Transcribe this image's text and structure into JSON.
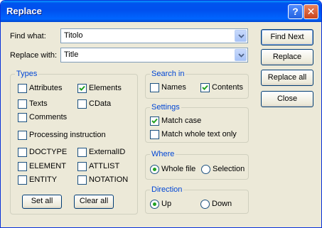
{
  "window": {
    "title": "Replace",
    "help_glyph": "?",
    "close_glyph": "✕"
  },
  "find": {
    "label": "Find what:",
    "value": "Titolo"
  },
  "replace": {
    "label": "Replace with:",
    "value": "Title"
  },
  "buttons": {
    "find_next": "Find Next",
    "replace": "Replace",
    "replace_all": "Replace all",
    "close": "Close"
  },
  "types": {
    "title": "Types",
    "attributes": {
      "label": "Attributes",
      "checked": false
    },
    "elements": {
      "label": "Elements",
      "checked": true
    },
    "texts": {
      "label": "Texts",
      "checked": false
    },
    "cdata": {
      "label": "CData",
      "checked": false
    },
    "comments": {
      "label": "Comments",
      "checked": false
    },
    "processing_instruction": {
      "label": "Processing instruction",
      "checked": false
    },
    "doctype": {
      "label": "DOCTYPE",
      "checked": false
    },
    "externalid": {
      "label": "ExternalID",
      "checked": false
    },
    "element": {
      "label": "ELEMENT",
      "checked": false
    },
    "attlist": {
      "label": "ATTLIST",
      "checked": false
    },
    "entity": {
      "label": "ENTITY",
      "checked": false
    },
    "notation": {
      "label": "NOTATION",
      "checked": false
    },
    "set_all": "Set all",
    "clear_all": "Clear all"
  },
  "search_in": {
    "title": "Search in",
    "names": {
      "label": "Names",
      "checked": false
    },
    "contents": {
      "label": "Contents",
      "checked": true
    }
  },
  "settings": {
    "title": "Settings",
    "match_case": {
      "label": "Match case",
      "checked": true
    },
    "match_whole": {
      "label": "Match whole text only",
      "checked": false
    }
  },
  "where": {
    "title": "Where",
    "whole_file": {
      "label": "Whole file",
      "selected": true
    },
    "selection": {
      "label": "Selection",
      "selected": false
    }
  },
  "direction": {
    "title": "Direction",
    "up": {
      "label": "Up",
      "selected": true
    },
    "down": {
      "label": "Down",
      "selected": false
    }
  }
}
